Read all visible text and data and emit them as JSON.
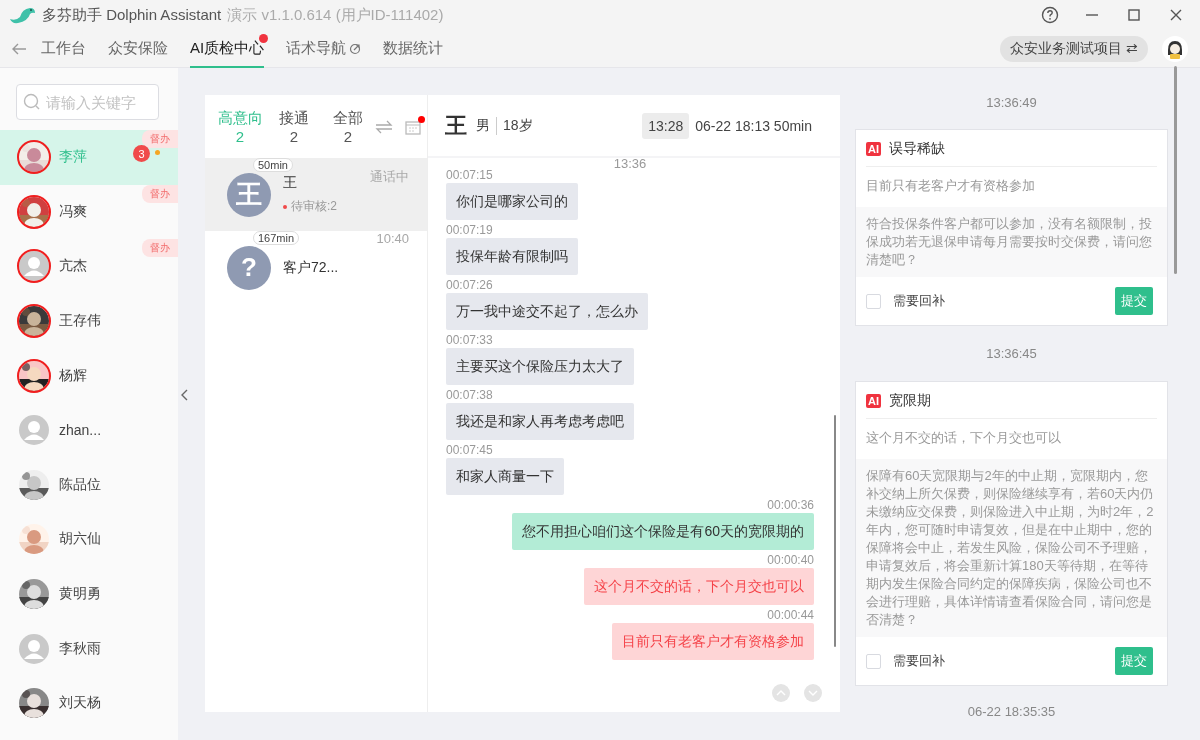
{
  "app": {
    "name": "多芬助手 Dolphin Assistant",
    "version": "演示 v1.1.0.614 (用户ID-111402)"
  },
  "nav": {
    "tabs": [
      {
        "label": "工作台",
        "selected": false,
        "dot": false,
        "external": false
      },
      {
        "label": "众安保险",
        "selected": false,
        "dot": false,
        "external": false
      },
      {
        "label": "AI质检中心",
        "selected": true,
        "dot": true,
        "external": false
      },
      {
        "label": "话术导航",
        "selected": false,
        "dot": false,
        "external": true
      },
      {
        "label": "数据统计",
        "selected": false,
        "dot": false,
        "external": false
      }
    ],
    "project": "众安业务测试项目",
    "switch_glyph": "⇄"
  },
  "search": {
    "placeholder": "请输入关键字"
  },
  "contacts": [
    {
      "name": "李萍",
      "selected": true,
      "flagged": true,
      "badge": "督办",
      "unread": "3",
      "dot": true
    },
    {
      "name": "冯爽",
      "selected": false,
      "flagged": true,
      "badge": "督办",
      "dot": false
    },
    {
      "name": "亢杰",
      "selected": false,
      "flagged": true,
      "badge": "督办",
      "dot": false,
      "kind": "default"
    },
    {
      "name": "王存伟",
      "selected": false,
      "flagged": true,
      "dot": false
    },
    {
      "name": "杨辉",
      "selected": false,
      "flagged": true,
      "dot": false
    },
    {
      "name": "zhan...",
      "selected": false,
      "flagged": false,
      "dot": false,
      "kind": "default"
    },
    {
      "name": "陈品位",
      "selected": false,
      "flagged": false,
      "dot": false
    },
    {
      "name": "胡六仙",
      "selected": false,
      "flagged": false,
      "dot": false
    },
    {
      "name": "黄明勇",
      "selected": false,
      "flagged": false,
      "dot": false
    },
    {
      "name": "李秋雨",
      "selected": false,
      "flagged": false,
      "dot": false,
      "kind": "default"
    },
    {
      "name": "刘天杨",
      "selected": false,
      "flagged": false,
      "dot": false
    }
  ],
  "call_filters": [
    {
      "label": "高意向",
      "count": "2",
      "selected": true
    },
    {
      "label": "接通",
      "count": "2",
      "selected": false
    },
    {
      "label": "全部",
      "count": "2",
      "selected": false
    }
  ],
  "calendar_dot": true,
  "calls": [
    {
      "avatar_text": "王",
      "duration": "50min",
      "name": "王",
      "status": "通话中",
      "pending": "待审核:2",
      "selected": true
    },
    {
      "avatar_text": "?",
      "duration": "167min",
      "name": "客户72...",
      "status": "10:40",
      "selected": false
    }
  ],
  "chat": {
    "header": {
      "avatar_text": "王",
      "gender": "男",
      "age": "18岁",
      "time_badge": "13:28",
      "info": "06-22 18:13 50min"
    },
    "top_time": "13:36",
    "messages": [
      {
        "time": "00:07:15",
        "text": "你们是哪家公司的",
        "kind": "customer"
      },
      {
        "time": "00:07:19",
        "text": "投保年龄有限制吗",
        "kind": "customer"
      },
      {
        "time": "00:07:26",
        "text": "万一我中途交不起了，怎么办",
        "kind": "customer"
      },
      {
        "time": "00:07:33",
        "text": "主要买这个保险压力太大了",
        "kind": "customer"
      },
      {
        "time": "00:07:38",
        "text": "我还是和家人再考虑考虑吧",
        "kind": "customer"
      },
      {
        "time": "00:07:45",
        "text": "和家人商量一下",
        "kind": "customer"
      },
      {
        "time": "00:00:36",
        "text": "您不用担心咱们这个保险是有60天的宽限期的",
        "kind": "agent",
        "violation": false
      },
      {
        "time": "00:00:40",
        "text": "这个月不交的话，下个月交也可以",
        "kind": "agent",
        "violation": true
      },
      {
        "time": "00:00:44",
        "text": "目前只有老客户才有资格参加",
        "kind": "agent",
        "violation": true
      }
    ]
  },
  "review": {
    "items": [
      {
        "time": "13:36:49",
        "tag": "AI",
        "title": "误导稀缺",
        "quote": "目前只有老客户才有资格参加",
        "answer": "符合投保条件客户都可以参加，没有名额限制，投保成功若无退保申请每月需要按时交保费，请问您清楚吧？",
        "callback_label": "需要回补",
        "needs_callback": false,
        "submit": "提交"
      },
      {
        "time": "13:36:45",
        "tag": "AI",
        "title": "宽限期",
        "quote": "这个月不交的话，下个月交也可以",
        "answer": "保障有60天宽限期与2年的中止期，宽限期内，您补交纳上所欠保费，则保险继续享有，若60天内仍未缴纳应交保费，则保险进入中止期，为时2年，2年内，您可随时申请复效，但是在中止期中，您的保障将会中止，若发生风险，保险公司不予理赔，申请复效后，将会重新计算180天等待期，在等待期内发生保险合同约定的保障疾病，保险公司也不会进行理赔，具体详情请查看保险合同，请问您是否清楚？",
        "callback_label": "需要回补",
        "needs_callback": false,
        "submit": "提交"
      }
    ],
    "footer_time": "06-22 18:35:35"
  }
}
